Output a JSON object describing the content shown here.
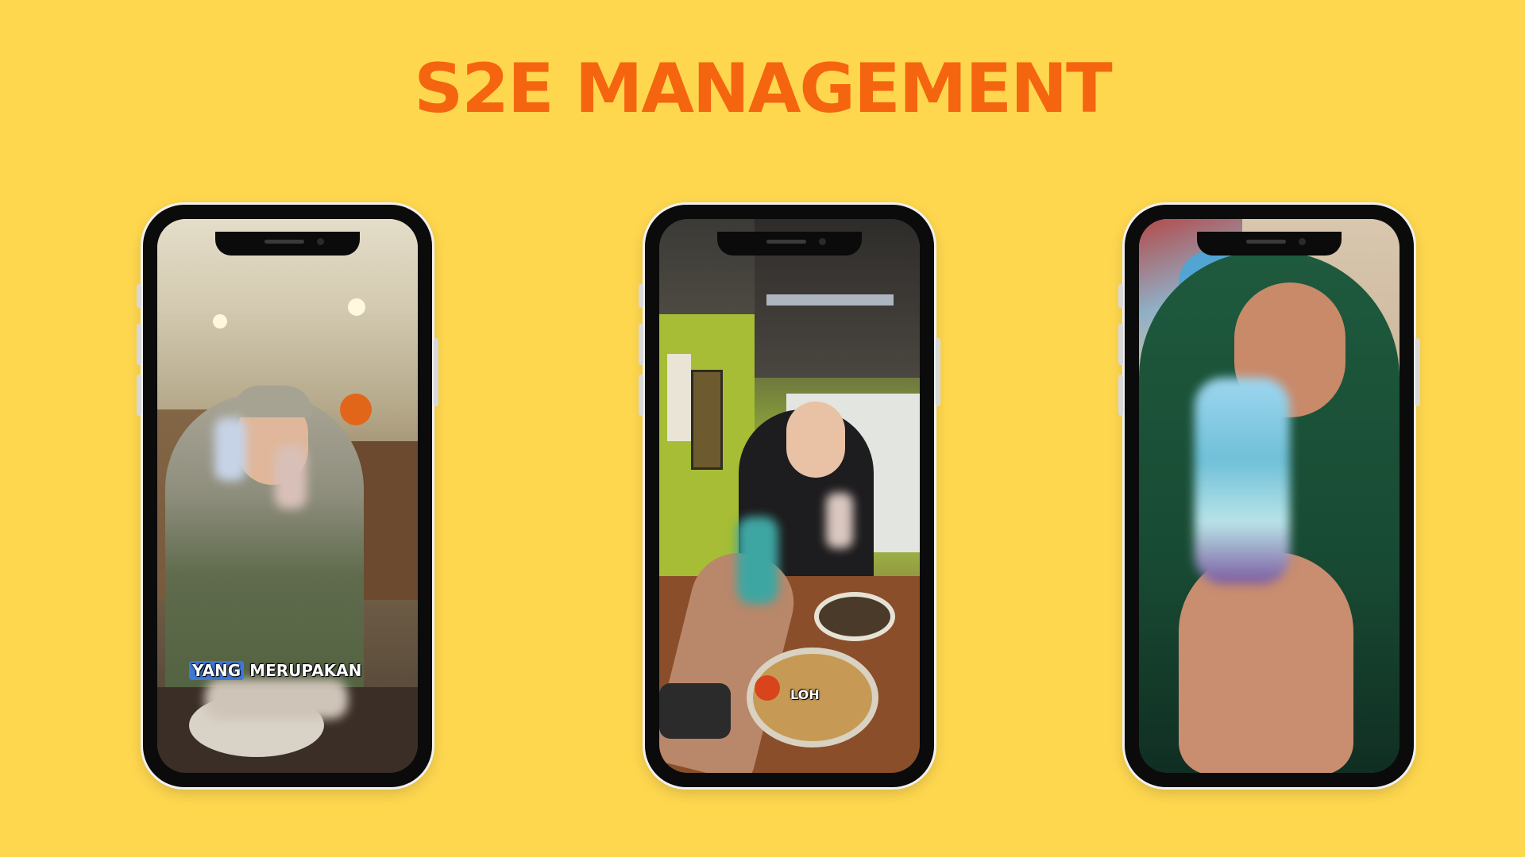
{
  "colors": {
    "background": "#fed74f",
    "title": "#f5650f",
    "phone_frame": "#0b0b0b"
  },
  "title": "S2E MANAGEMENT",
  "videos": [
    {
      "caption": "YANG MERUPAKAN",
      "caption_highlight": "YANG",
      "caption_rest": "MERUPAKAN"
    },
    {
      "caption": "LOH"
    },
    {
      "caption": ""
    }
  ]
}
